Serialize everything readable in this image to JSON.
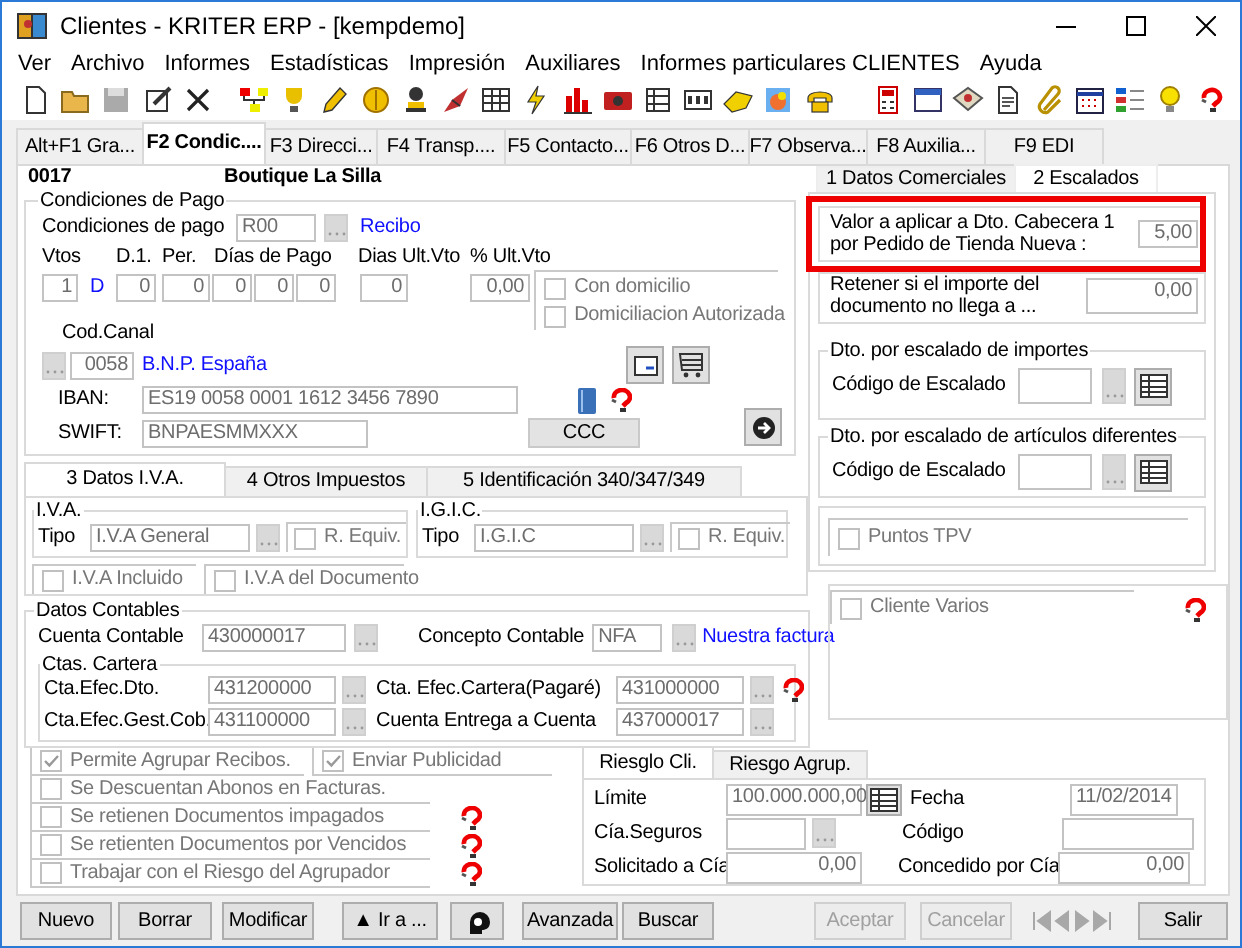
{
  "window": {
    "title": "Clientes - KRITER ERP - [kempdemo]"
  },
  "menu": [
    "Ver",
    "Archivo",
    "Informes",
    "Estadísticas",
    "Impresión",
    "Auxiliares",
    "Informes particulares CLIENTES",
    "Ayuda"
  ],
  "tabs": [
    {
      "label": "Alt+F1 Gra...",
      "selected": false
    },
    {
      "label": "F2 Condic....",
      "selected": true
    },
    {
      "label": "F3 Direcci...",
      "selected": false
    },
    {
      "label": "F4 Transp....",
      "selected": false
    },
    {
      "label": "F5 Contacto...",
      "selected": false
    },
    {
      "label": "F6 Otros D...",
      "selected": false
    },
    {
      "label": "F7 Observa...",
      "selected": false
    },
    {
      "label": "F8 Auxilia...",
      "selected": false
    },
    {
      "label": "F9 EDI",
      "selected": false
    }
  ],
  "client": {
    "code": "0017",
    "name": "Boutique La Silla"
  },
  "payment": {
    "legend": "Condiciones de Pago",
    "condition_label": "Condiciones de pago",
    "condition_code": "R00",
    "condition_name": "Recibo",
    "columns": [
      "Vtos",
      "D.1.",
      "Per.",
      "Días de Pago",
      "Dias Ult.Vto",
      "% Ult.Vto"
    ],
    "vtos": "1",
    "vtos_unit": "D",
    "d1": "0",
    "per": "0",
    "days": [
      "0",
      "0",
      "0"
    ],
    "last_days": "0",
    "last_percent": "0,00",
    "checks": [
      {
        "label": "Con domicilio",
        "checked": false
      },
      {
        "label": "Domiciliacion Autorizada",
        "checked": false
      }
    ],
    "channel_label": "Cod.Canal",
    "channel_code": "0058",
    "channel_name": "B.N.P. España",
    "iban_label": "IBAN:",
    "iban": "ES19 0058 0001 1612 3456 7890",
    "swift_label": "SWIFT:",
    "swift": "BNPAESMMXXX",
    "ccc_button": "CCC"
  },
  "subtabs": [
    {
      "label": "3 Datos I.V.A.",
      "selected": true
    },
    {
      "label": "4 Otros Impuestos",
      "selected": false
    },
    {
      "label": "5 Identificación 340/347/349",
      "selected": false
    }
  ],
  "taxes": [
    {
      "legend": "I.V.A.",
      "type_label": "Tipo",
      "type": "I.V.A General",
      "equiv": {
        "label": "R. Equiv.",
        "checked": false
      }
    },
    {
      "legend": "I.G.I.C.",
      "type_label": "Tipo",
      "type": "I.G.I.C",
      "equiv": {
        "label": "R. Equiv.",
        "checked": false
      }
    }
  ],
  "tax_checks": [
    {
      "label": "I.V.A Incluido",
      "checked": false
    },
    {
      "label": "I.V.A del Documento",
      "checked": false
    }
  ],
  "accounting": {
    "legend": "Datos Contables",
    "account_label": "Cuenta Contable",
    "account": "430000017",
    "concept_label": "Concepto Contable",
    "concept": "NFA",
    "concept_name": "Nuestra factura",
    "portfolio_legend": "Ctas. Cartera",
    "portfolio": [
      {
        "label": "Cta.Efec.Dto.",
        "value": "431200000",
        "help": false
      },
      {
        "label": "Cta. Efec.Cartera(Pagaré)",
        "value": "431000000",
        "help": true
      },
      {
        "label": "Cta.Efec.Gest.Cob.",
        "value": "431100000",
        "help": false
      },
      {
        "label": "Cuenta Entrega a Cuenta",
        "value": "437000017",
        "help": false
      }
    ]
  },
  "commercial": {
    "tabs": [
      {
        "label": "1 Datos Comerciales",
        "selected": false
      },
      {
        "label": "2 Escalados",
        "selected": true
      }
    ],
    "highlighted": true,
    "value_label": "Valor a aplicar a Dto. Cabecera 1 por Pedido de Tienda Nueva :",
    "value": "5,00",
    "retain_label": "Retener si el importe del documento no llega a ...",
    "retain": "0,00",
    "scales": [
      {
        "legend": "Dto. por escalado de importes",
        "label": "Código de Escalado"
      },
      {
        "legend": "Dto. por escalado de artículos diferentes",
        "label": "Código de Escalado"
      }
    ],
    "pos_points": {
      "label": "Puntos TPV",
      "checked": false
    }
  },
  "various_client": {
    "label": "Cliente Varios",
    "checked": false,
    "help": true
  },
  "option_rows": [
    [
      {
        "label": "Permite Agrupar Recibos.",
        "checked": true,
        "help": false
      },
      {
        "label": "Enviar Publicidad",
        "checked": true,
        "help": false
      }
    ],
    [
      {
        "label": "Se Descuentan Abonos en Facturas.",
        "checked": false,
        "help": false
      }
    ],
    [
      {
        "label": "Se retienen Documentos impagados",
        "checked": false,
        "help": true
      }
    ],
    [
      {
        "label": "Se retienten Documentos por Vencidos",
        "checked": false,
        "help": true
      }
    ],
    [
      {
        "label": "Trabajar con el Riesgo del Agrupador",
        "checked": false,
        "help": true
      }
    ]
  ],
  "risk": {
    "tabs": [
      {
        "label": "Riesglo Cli.",
        "selected": true
      },
      {
        "label": "Riesgo Agrup.",
        "selected": false
      }
    ],
    "limit_label": "Límite",
    "limit": "100.000.000,00",
    "date_label": "Fecha",
    "date": "11/02/2014",
    "insurer_label": "Cía.Seguros",
    "code_label": "Código",
    "requested_label": "Solicitado a Cía",
    "requested": "0,00",
    "granted_label": "Concedido por Cía",
    "granted": "0,00"
  },
  "buttons": [
    {
      "kind": "text",
      "label": "Nuevo",
      "disabled": false
    },
    {
      "kind": "text",
      "label": "Borrar",
      "disabled": false
    },
    {
      "kind": "text",
      "label": "Modificar",
      "disabled": false
    },
    {
      "kind": "text",
      "label": "▲ Ir a ...",
      "disabled": false
    },
    {
      "kind": "icon",
      "disabled": false
    },
    {
      "kind": "text",
      "label": "Avanzada",
      "disabled": false
    },
    {
      "kind": "text",
      "label": "Buscar",
      "disabled": false
    },
    {
      "kind": "text",
      "label": "Aceptar",
      "disabled": true
    },
    {
      "kind": "text",
      "label": "Cancelar",
      "disabled": true
    },
    {
      "kind": "nav",
      "disabled": true
    },
    {
      "kind": "text",
      "label": "Salir",
      "disabled": false
    }
  ]
}
